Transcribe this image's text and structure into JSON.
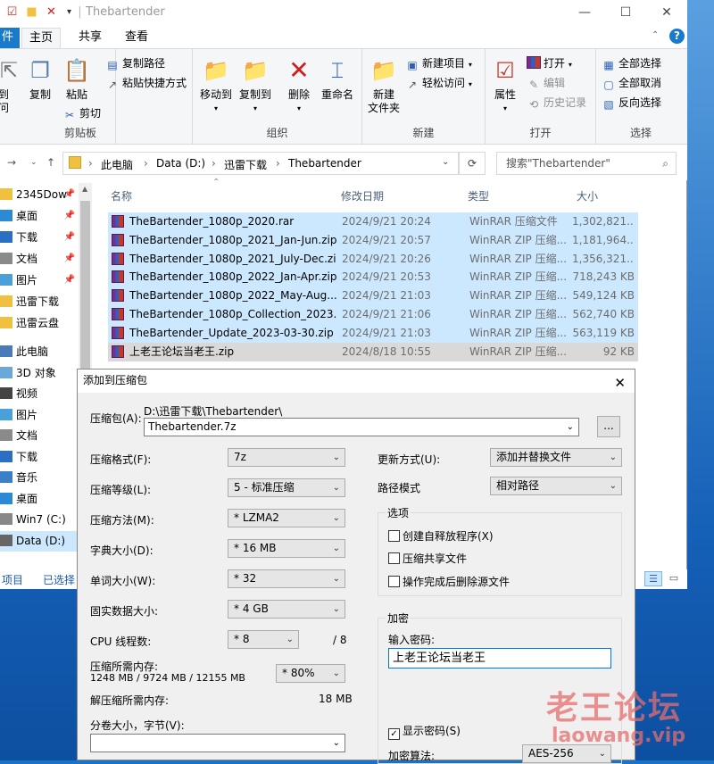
{
  "explorer": {
    "title": "Thebartender",
    "tabs": [
      "件",
      "主页",
      "共享",
      "查看"
    ],
    "ribbon": {
      "clipboard": {
        "group_label": "剪贴板",
        "pin_label": "到\n问",
        "copy": "复制",
        "paste": "粘贴",
        "copy_path": "复制路径",
        "paste_shortcut": "粘贴快捷方式",
        "cut": "剪切"
      },
      "organize": {
        "group_label": "组织",
        "move_to": "移动到",
        "copy_to": "复制到",
        "delete": "删除",
        "rename": "重命名"
      },
      "new": {
        "group_label": "新建",
        "new_folder_1": "新建",
        "new_folder_2": "文件夹",
        "new_item": "新建项目",
        "easy_access": "轻松访问"
      },
      "open": {
        "group_label": "打开",
        "properties": "属性",
        "open": "打开",
        "edit": "编辑",
        "history": "历史记录"
      },
      "select": {
        "group_label": "选择",
        "select_all": "全部选择",
        "select_none": "全部取消",
        "invert": "反向选择"
      }
    },
    "address": {
      "crumbs": [
        "此电脑",
        "Data (D:)",
        "迅雷下载",
        "Thebartender"
      ],
      "search_placeholder": "搜索\"Thebartender\""
    },
    "nav": [
      {
        "label": "2345Dow",
        "pinned": true
      },
      {
        "label": "桌面",
        "pinned": true
      },
      {
        "label": "下载",
        "pinned": true
      },
      {
        "label": "文档",
        "pinned": true
      },
      {
        "label": "图片",
        "pinned": true
      },
      {
        "label": "迅雷下载",
        "pinned": false
      },
      {
        "label": "迅雷云盘",
        "pinned": false
      },
      {
        "label": "此电脑",
        "pinned": false
      },
      {
        "label": "3D 对象",
        "pinned": false
      },
      {
        "label": "视频",
        "pinned": false
      },
      {
        "label": "图片",
        "pinned": false
      },
      {
        "label": "文档",
        "pinned": false
      },
      {
        "label": "下载",
        "pinned": false
      },
      {
        "label": "音乐",
        "pinned": false
      },
      {
        "label": "桌面",
        "pinned": false
      },
      {
        "label": "Win7 (C:)",
        "pinned": false
      },
      {
        "label": "Data (D:)",
        "pinned": false
      }
    ],
    "columns": {
      "name": "名称",
      "date": "修改日期",
      "type": "类型",
      "size": "大小"
    },
    "files": [
      {
        "name": "TheBartender_1080p_2020.rar",
        "date": "2024/9/21 20:24",
        "type": "WinRAR 压缩文件",
        "size": "1,302,821..."
      },
      {
        "name": "TheBartender_1080p_2021_Jan-Jun.zip",
        "date": "2024/9/21 20:57",
        "type": "WinRAR ZIP 压缩...",
        "size": "1,181,964..."
      },
      {
        "name": "TheBartender_1080p_2021_July-Dec.zip",
        "date": "2024/9/21 20:26",
        "type": "WinRAR ZIP 压缩...",
        "size": "1,356,321..."
      },
      {
        "name": "TheBartender_1080p_2022_Jan-Apr.zip",
        "date": "2024/9/21 20:53",
        "type": "WinRAR ZIP 压缩...",
        "size": "718,243 KB"
      },
      {
        "name": "TheBartender_1080p_2022_May-Aug....",
        "date": "2024/9/21 21:03",
        "type": "WinRAR ZIP 压缩...",
        "size": "549,124 KB"
      },
      {
        "name": "TheBartender_1080p_Collection_2023...",
        "date": "2024/9/21 21:06",
        "type": "WinRAR ZIP 压缩...",
        "size": "562,740 KB"
      },
      {
        "name": "TheBartender_Update_2023-03-30.zip",
        "date": "2024/9/21 21:03",
        "type": "WinRAR ZIP 压缩...",
        "size": "563,119 KB"
      },
      {
        "name": "上老王论坛当老王.zip",
        "date": "2024/8/18 10:55",
        "type": "WinRAR ZIP 压缩...",
        "size": "92 KB"
      }
    ],
    "status": {
      "items": "项目",
      "selected": "已选择"
    }
  },
  "dialog": {
    "title": "添加到压缩包",
    "archive_label": "压缩包(A):",
    "archive_path": "D:\\迅雷下载\\Thebartender\\",
    "archive_name": "Thebartender.7z",
    "browse": "...",
    "format_label": "压缩格式(F):",
    "format_value": "7z",
    "level_label": "压缩等级(L):",
    "level_value": "5 - 标准压缩",
    "method_label": "压缩方法(M):",
    "method_value": "* LZMA2",
    "dict_label": "字典大小(D):",
    "dict_value": "* 16 MB",
    "word_label": "单词大小(W):",
    "word_value": "* 32",
    "solid_label": "固实数据大小:",
    "solid_value": "* 4 GB",
    "cpu_label": "CPU 线程数:",
    "cpu_value": "* 8",
    "cpu_total": "/ 8",
    "mem_label": "压缩所需内存:",
    "mem_detail": "1248 MB / 9724 MB / 12155 MB",
    "mem_percent": "* 80%",
    "decomp_label": "解压缩所需内存:",
    "decomp_value": "18 MB",
    "split_label": "分卷大小，字节(V):",
    "split_value": "",
    "update_label": "更新方式(U):",
    "update_value": "添加并替换文件",
    "path_label": "路径模式",
    "path_value": "相对路径",
    "options_title": "选项",
    "opt_sfx": "创建自释放程序(X)",
    "opt_shared": "压缩共享文件",
    "opt_delete": "操作完成后删除源文件",
    "encrypt_title": "加密",
    "password_label": "输入密码:",
    "password_value": "上老王论坛当老王",
    "show_password": "显示密码(S)",
    "enc_method_label": "加密算法:",
    "enc_method_value": "AES-256"
  },
  "watermark": {
    "line1": "老王论坛",
    "line2": "laowang.vip"
  }
}
